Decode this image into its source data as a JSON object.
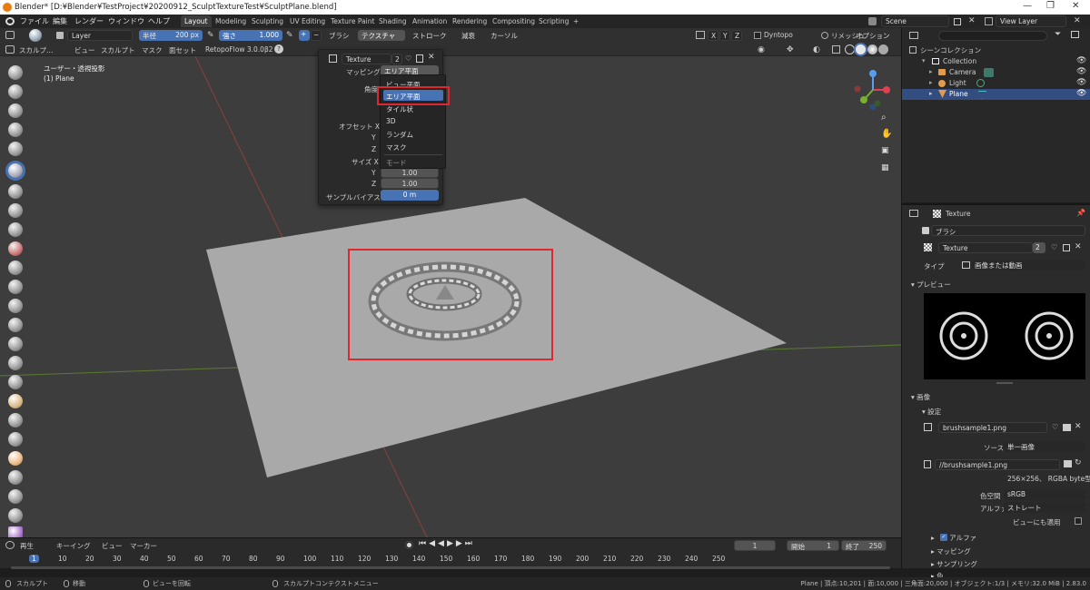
{
  "window": {
    "title": "Blender* [D:¥Blender¥TestProject¥20200912_SculptTextureTest¥SculptPlane.blend]",
    "minimize": "—",
    "maximize": "❐",
    "close": "✕"
  },
  "menubar": {
    "menus": [
      "ファイル",
      "編集",
      "レンダー",
      "ウィンドウ",
      "ヘルプ"
    ],
    "workspaces": [
      "Layout",
      "Modeling",
      "Sculpting",
      "UV Editing",
      "Texture Paint",
      "Shading",
      "Animation",
      "Rendering",
      "Compositing",
      "Scripting"
    ],
    "add_tab": "+",
    "scene": "Scene",
    "view_layer": "View Layer"
  },
  "tool_header": {
    "layer_field": "Layer",
    "radius_label": "半径",
    "radius_value": "200 px",
    "strength_label": "強さ",
    "strength_value": "1.000",
    "plus": "+",
    "minus": "−",
    "menus": [
      "ブラシ",
      "テクスチャ",
      "ストローク",
      "減衰",
      "カーソル"
    ],
    "axes": [
      "X",
      "Y",
      "Z"
    ],
    "dyntopo": "Dyntopo",
    "remesh": "リメッシュ",
    "options": "オプション"
  },
  "view_header": {
    "mode": "スカルプ…",
    "menus": [
      "ビュー",
      "スカルプト",
      "マスク",
      "面セット"
    ],
    "addon": "RetopoFlow 3.0.0β2"
  },
  "viewport": {
    "view_name": "ユーザー・透視投影",
    "object_name": "(1) Plane"
  },
  "texture_popup": {
    "texture_name": "Texture",
    "users": "2",
    "mapping_label": "マッピング",
    "mapping_value": "エリア平面",
    "angle_label": "角度",
    "offset_label": "オフセット X",
    "y_label": "Y",
    "z_label": "Z",
    "size_label": "サイズ X",
    "size_y": "1.00",
    "size_z": "1.00",
    "bias_label": "サンプルバイアス",
    "bias_value": "0 m",
    "dropdown_options": [
      "ビュー平面",
      "エリア平面",
      "タイル状",
      "3D",
      "ランダム",
      "マスク"
    ],
    "dropdown_title": "モード",
    "selected_option": "エリア平面"
  },
  "outliner": {
    "header": "シーンコレクション",
    "items": [
      {
        "label": "Collection",
        "icon": "collection-icon"
      },
      {
        "label": "Camera",
        "icon": "camera-icon"
      },
      {
        "label": "Light",
        "icon": "light-icon"
      },
      {
        "label": "Plane",
        "icon": "mesh-icon"
      }
    ]
  },
  "properties": {
    "header_title": "Texture",
    "brush_label": "ブラシ",
    "texture_name": "Texture",
    "users": "2",
    "type_label": "タイプ",
    "type_value": "画像または動画",
    "preview_label": "プレビュー",
    "image_label": "画像",
    "settings_label": "設定",
    "image_name": "brushsample1.png",
    "source_label": "ソース",
    "source_value": "単一画像",
    "filepath": "//brushsample1.png",
    "image_info": "256×256、 RGBA byte型",
    "colorspace_label": "色空間",
    "colorspace_value": "sRGB",
    "alpha_label": "アルファ",
    "alpha_value": "ストレート",
    "view_as_render": "ビューにも適用",
    "panels": [
      "アルファ",
      "マッピング",
      "サンプリング",
      "色"
    ]
  },
  "timeline": {
    "menus": [
      "再生",
      "キーイング",
      "ビュー",
      "マーカー"
    ],
    "current_frame": "1",
    "start_label": "開始",
    "start_value": "1",
    "end_label": "終了",
    "end_value": "250",
    "ticks": [
      "1",
      "10",
      "20",
      "30",
      "40",
      "50",
      "60",
      "70",
      "80",
      "90",
      "100",
      "110",
      "120",
      "130",
      "140",
      "150",
      "160",
      "170",
      "180",
      "190",
      "200",
      "210",
      "220",
      "230",
      "240",
      "250"
    ]
  },
  "statusbar": {
    "left_items": [
      "スカルプト",
      "移動",
      "ビューを回転",
      "スカルプトコンテクストメニュー"
    ],
    "stats": "Plane | 頂点:10,201 | 面:10,000 | 三角面:20,000 | オブジェクト:1/3 | メモリ:32.0 MiB | 2.83.0"
  },
  "colors": {
    "accent_blue": "#4772b3",
    "highlight_red": "#e0262e",
    "viewport_bg": "#3d3d3d",
    "plane": "#a9a9a9"
  }
}
